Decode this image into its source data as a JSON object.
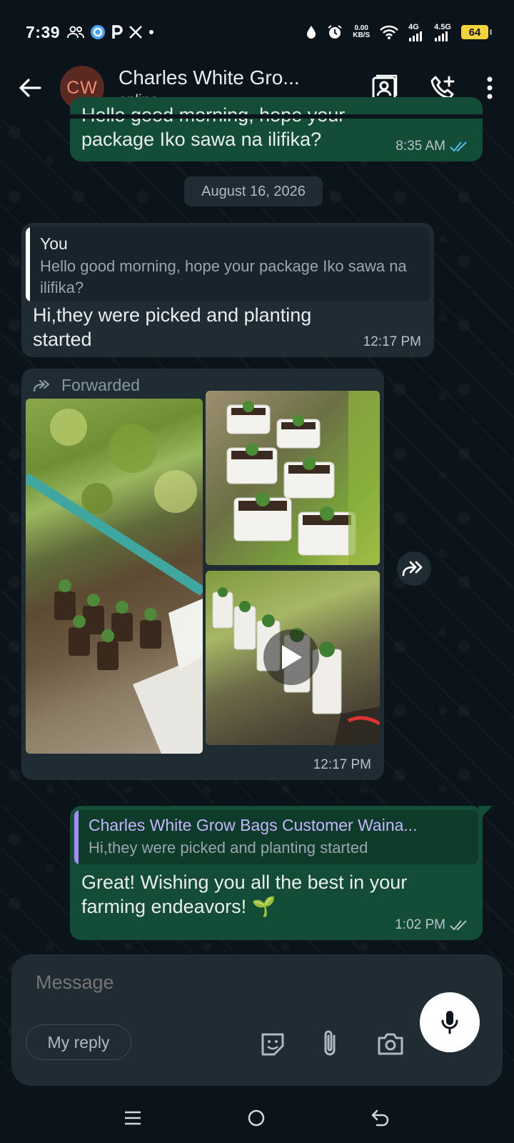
{
  "status_bar": {
    "time": "7:39",
    "left_icons": [
      "people-icon",
      "circle-arrow-icon",
      "p-icon",
      "x-icon",
      "dot-icon"
    ],
    "net_speed_value": "0.00",
    "net_speed_unit": "KB/S",
    "network_1": "4G",
    "network_2": "4.5G",
    "battery": "64"
  },
  "header": {
    "avatar_initials": "CW",
    "title": "Charles White Gro...",
    "subtitle": "online"
  },
  "messages": {
    "m1": {
      "text": "Hello good morning, hope your package Iko sawa na ilifika?",
      "time": "8:35 AM",
      "status": "read"
    },
    "date_separator": "August 16, 2026",
    "m2": {
      "quote_author": "You",
      "quote_text": "Hello good morning, hope your package Iko sawa na ilifika?",
      "text": "Hi,they were picked and planting started",
      "time": "12:17 PM"
    },
    "m3": {
      "forwarded_label": "Forwarded",
      "time": "12:17 PM"
    },
    "m4": {
      "quote_author": "Charles White Grow Bags Customer Waina...",
      "quote_text": "Hi,they were picked and planting started",
      "text": "Great! Wishing you all the best in your farming endeavors! 🌱",
      "time": "1:02 PM",
      "status": "delivered"
    }
  },
  "composer": {
    "placeholder": "Message",
    "suggestion_chip": "My reply"
  },
  "colors": {
    "background": "#0b141a",
    "outgoing_bubble": "#144d37",
    "incoming_bubble": "#1f2c34",
    "read_tick": "#53bdeb",
    "quote_bar_you": "#ffffff",
    "quote_bar_contact": "#a78bfa"
  }
}
